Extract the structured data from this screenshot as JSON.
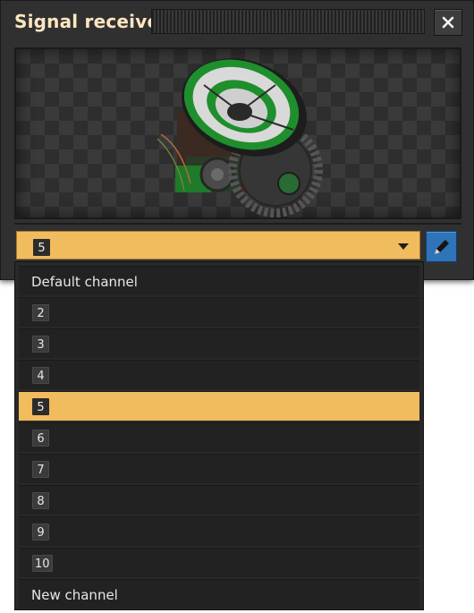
{
  "window": {
    "title": "Signal receiver",
    "close_icon": "close-icon"
  },
  "preview": {
    "image": "radar-dish-entity"
  },
  "dropdown": {
    "selected_value": "5",
    "arrow_icon": "chevron-down-icon"
  },
  "edit_button": {
    "icon": "pencil-icon",
    "accent": "#2f73b8"
  },
  "options": [
    {
      "label": "Default channel",
      "type": "text"
    },
    {
      "label": "2",
      "type": "tag"
    },
    {
      "label": "3",
      "type": "tag"
    },
    {
      "label": "4",
      "type": "tag"
    },
    {
      "label": "5",
      "type": "tag",
      "selected": true
    },
    {
      "label": "6",
      "type": "tag"
    },
    {
      "label": "7",
      "type": "tag"
    },
    {
      "label": "8",
      "type": "tag"
    },
    {
      "label": "9",
      "type": "tag"
    },
    {
      "label": "10",
      "type": "tag"
    },
    {
      "label": "New channel",
      "type": "text"
    }
  ],
  "colors": {
    "selection": "#f0bc5e",
    "title": "#ffe6c0",
    "panel": "#313031"
  }
}
